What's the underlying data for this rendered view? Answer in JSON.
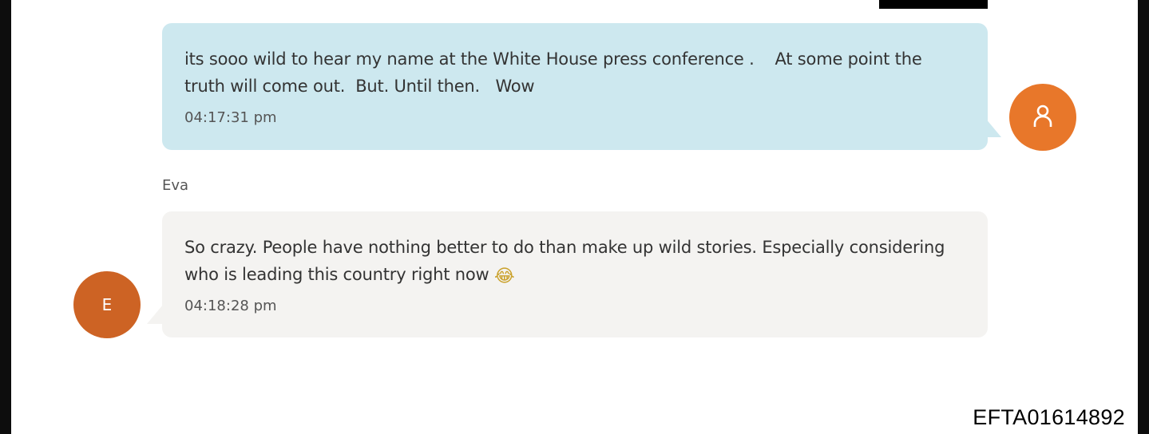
{
  "conversation": {
    "messages": [
      {
        "direction": "outgoing",
        "text": "its sooo wild to hear my name at the White House press conference .    At some point the truth will come out.  But. Until then.   Wow",
        "time": "04:17:31 pm",
        "avatar_icon": "person-icon"
      },
      {
        "direction": "incoming",
        "sender": "Eva",
        "text": "So crazy. People have nothing better to do than make up wild stories. Especially considering who is leading this country right now",
        "emoji": "😂",
        "time": "04:18:28 pm",
        "avatar_initial": "E"
      }
    ]
  },
  "footer": {
    "document_id": "EFTA01614892"
  },
  "colors": {
    "outgoing_bubble": "#cde8ef",
    "incoming_bubble": "#f4f3f1",
    "avatar_me": "#e8772a",
    "avatar_eva": "#cd6324"
  }
}
